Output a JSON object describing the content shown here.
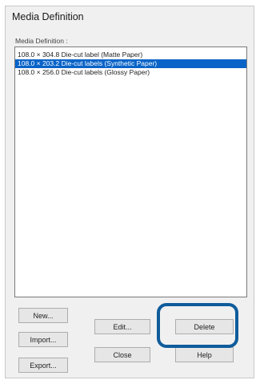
{
  "dialog": {
    "title": "Media Definition",
    "list_label": "Media Definition :",
    "items": [
      {
        "label": "108.0 × 304.8 Die-cut label (Matte Paper)",
        "selected": false
      },
      {
        "label": "108.0 × 203.2 Die-cut labels (Synthetic Paper)",
        "selected": true
      },
      {
        "label": "108.0 × 256.0 Die-cut labels (Glossy Paper)",
        "selected": false
      }
    ]
  },
  "buttons": {
    "new": "New...",
    "import": "Import...",
    "export": "Export...",
    "edit": "Edit...",
    "close": "Close",
    "delete": "Delete",
    "help": "Help"
  },
  "colors": {
    "selection": "#0a64c8",
    "callout_ring": "#0f5c9c"
  }
}
